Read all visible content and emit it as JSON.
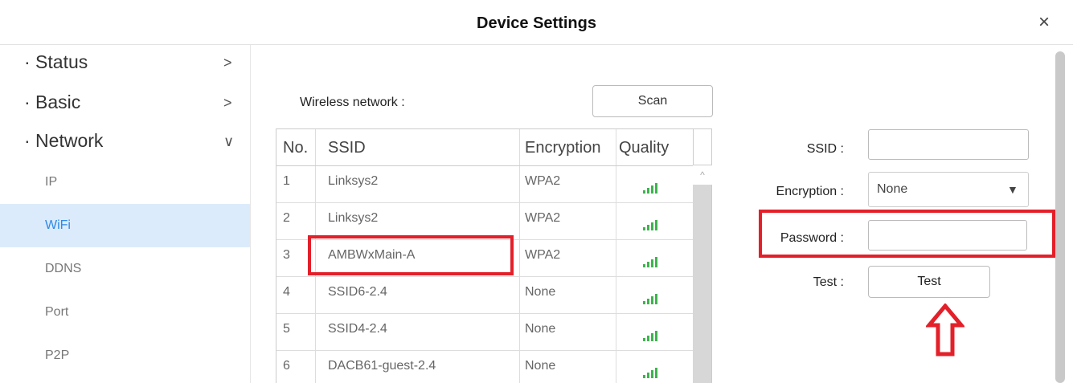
{
  "window": {
    "title": "Device Settings",
    "close_symbol": "×"
  },
  "sidebar": {
    "menus": [
      {
        "label": "· Status",
        "chevron": ">"
      },
      {
        "label": "· Basic",
        "chevron": ">"
      },
      {
        "label": "· Network",
        "chevron": "∨"
      }
    ],
    "sub_items": [
      "IP",
      "WiFi",
      "DDNS",
      "Port",
      "P2P"
    ],
    "active_sub_item": "WiFi"
  },
  "wireless": {
    "label": "Wireless network :",
    "scan_label": "Scan",
    "columns": [
      "No.",
      "SSID",
      "Encryption",
      "Quality"
    ],
    "rows": [
      {
        "no": "1",
        "ssid": "Linksys2",
        "enc": "WPA2"
      },
      {
        "no": "2",
        "ssid": "Linksys2",
        "enc": "WPA2"
      },
      {
        "no": "3",
        "ssid": "AMBWxMain-A",
        "enc": "WPA2"
      },
      {
        "no": "4",
        "ssid": "SSID6-2.4",
        "enc": "None"
      },
      {
        "no": "5",
        "ssid": "SSID4-2.4",
        "enc": "None"
      },
      {
        "no": "6",
        "ssid": "DACB61-guest-2.4",
        "enc": "None"
      }
    ],
    "scroll_up_symbol": "^"
  },
  "form": {
    "ssid_label": "SSID :",
    "ssid_value": "",
    "encryption_label": "Encryption :",
    "encryption_value": "None",
    "password_label": "Password :",
    "password_value": "",
    "test_label": "Test :",
    "test_button": "Test"
  },
  "colors": {
    "highlight": "#e3202a",
    "signal": "#3fb34f",
    "active_bg": "#dcebfb",
    "active_text": "#2d8ae6"
  }
}
